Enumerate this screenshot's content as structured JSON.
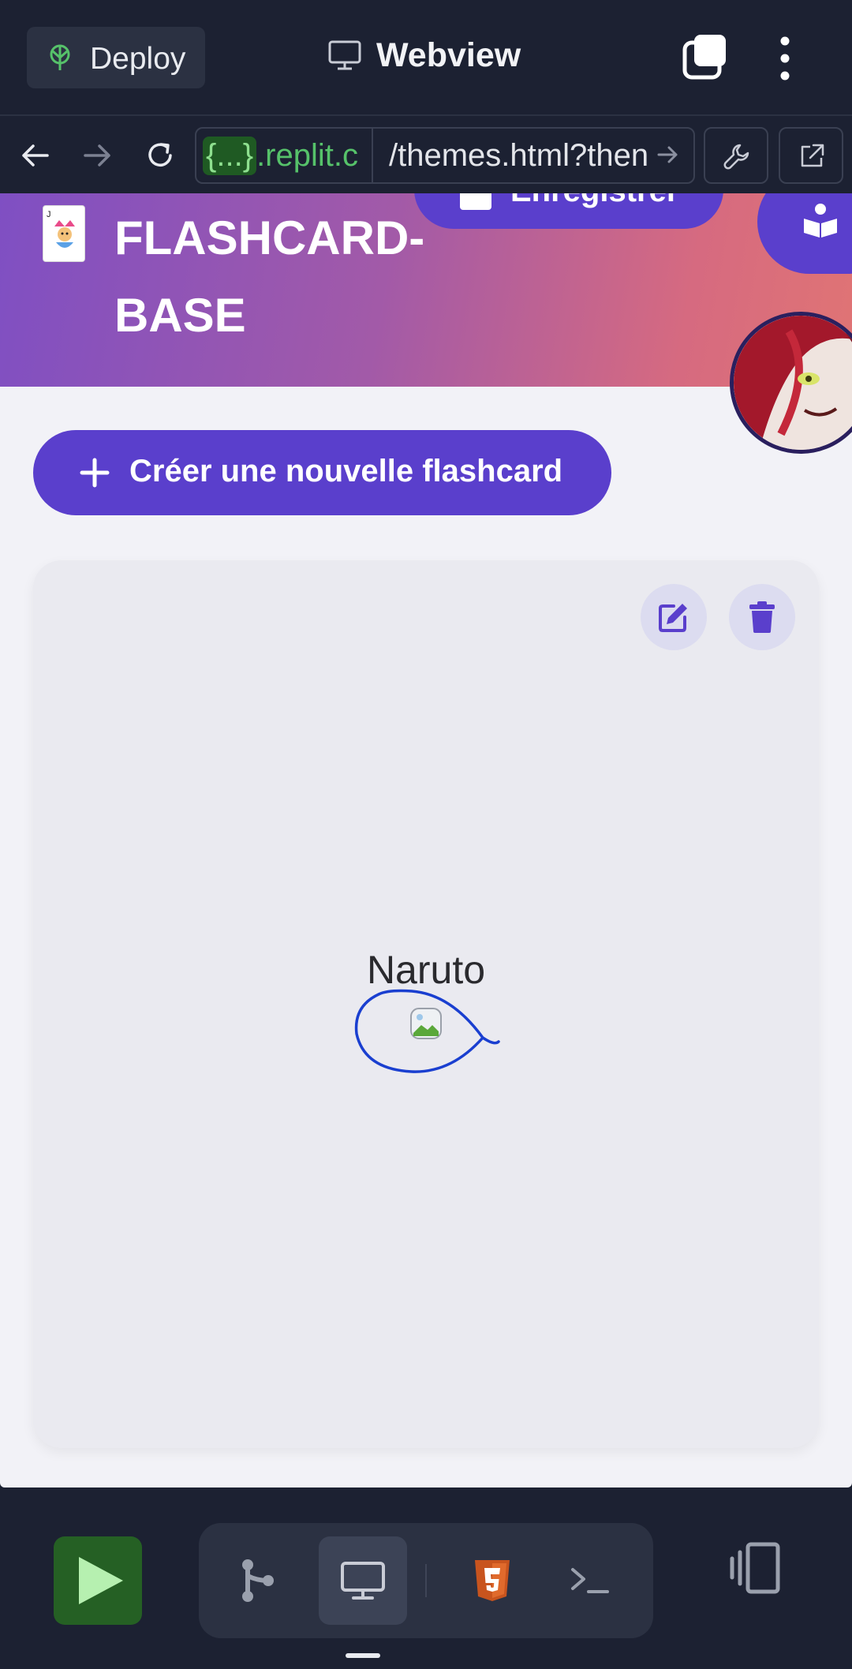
{
  "topbar": {
    "deploy_label": "Deploy",
    "title": "Webview",
    "icons": [
      "deploy-icon",
      "monitor-icon",
      "tabs-icon",
      "more-vertical-icon"
    ]
  },
  "urlbar": {
    "host_braces": "{...}",
    "host_suffix": ".replit.c",
    "path": "/themes.html?then",
    "icons": [
      "back-icon",
      "forward-icon",
      "reload-icon",
      "wrench-icon",
      "external-link-icon"
    ]
  },
  "page": {
    "site_title_line1": "FLASHCARD-",
    "site_title_line2": "BASE",
    "save_label": "Enregistrer",
    "create_label": "Créer une nouvelle flashcard",
    "card": {
      "title": "Naruto",
      "edit_icon": "edit-icon",
      "delete_icon": "trash-icon"
    }
  },
  "bottombar": {
    "icons": [
      "play-icon",
      "git-icon",
      "monitor-icon",
      "html5-icon",
      "terminal-icon",
      "layout-icon"
    ],
    "active_tool": "monitor-icon"
  },
  "colors": {
    "chrome": "#1c2132",
    "accent": "#5a3fcc",
    "header_gradient_start": "#7f4fc3",
    "header_gradient_end": "#e07474",
    "run_green": "#256024"
  }
}
